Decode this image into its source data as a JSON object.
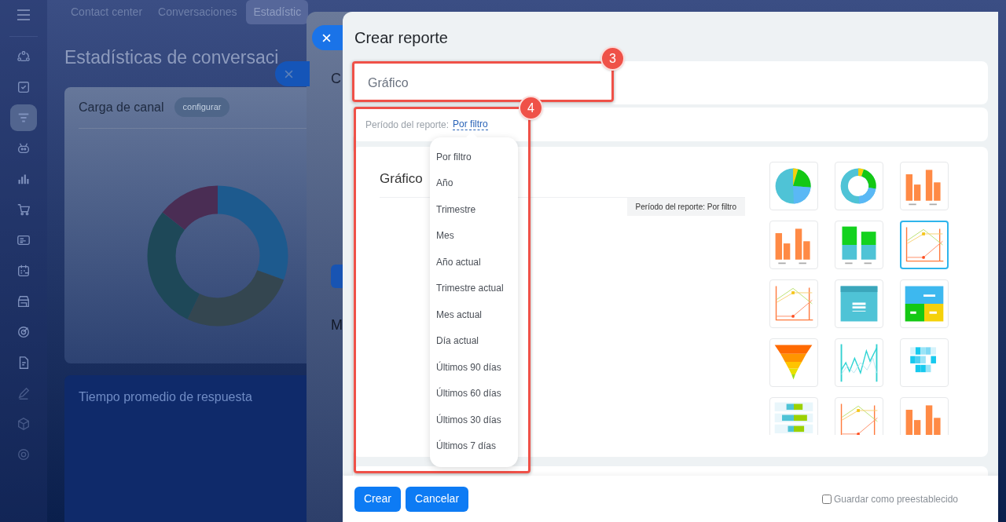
{
  "sidebar": {
    "items": [
      {
        "selected": false
      },
      {
        "selected": false
      },
      {
        "selected": true
      },
      {
        "selected": false
      },
      {
        "selected": false
      },
      {
        "selected": false
      },
      {
        "selected": false
      },
      {
        "selected": false
      },
      {
        "selected": false
      },
      {
        "selected": false
      },
      {
        "selected": false
      },
      {
        "selected": false
      },
      {
        "selected": false
      },
      {
        "selected": false
      }
    ]
  },
  "tabs": [
    {
      "label": "Contact center",
      "selected": false
    },
    {
      "label": "Conversaciones",
      "selected": false
    },
    {
      "label": "Estadístic",
      "selected": true
    }
  ],
  "page_title": "Estadísticas de conversaci",
  "cards": [
    {
      "title": "Carga de canal",
      "action": "configurar",
      "kind": "donut"
    },
    {
      "title": "Tiempo promedio de respuesta",
      "kind": "empty"
    }
  ],
  "side_panel": {
    "texts": [
      "C",
      "M"
    ]
  },
  "dialog": {
    "title": "Crear reporte",
    "name_field": {
      "value": "Gráfico"
    },
    "period": {
      "label": "Período del reporte:",
      "value": "Por filtro"
    },
    "period_options": [
      "Por filtro",
      "Año",
      "Trimestre",
      "Mes",
      "Año actual",
      "Trimestre actual",
      "Mes actual",
      "Día actual",
      "Últimos 90 días",
      "Últimos 60 días",
      "Últimos 30 días",
      "Últimos 7 días"
    ],
    "preview": {
      "title": "Gráfico",
      "tag": "Período del reporte: Por filtro"
    },
    "chart_types": [
      {
        "kind": "pie",
        "selected": false
      },
      {
        "kind": "donut",
        "selected": false
      },
      {
        "kind": "bar",
        "selected": false
      },
      {
        "kind": "bar",
        "selected": false
      },
      {
        "kind": "stacked",
        "selected": false
      },
      {
        "kind": "line",
        "selected": true
      },
      {
        "kind": "line",
        "selected": false
      },
      {
        "kind": "number",
        "selected": false
      },
      {
        "kind": "numbers",
        "selected": false
      },
      {
        "kind": "funnel",
        "selected": false
      },
      {
        "kind": "wave",
        "selected": false
      },
      {
        "kind": "heatmap",
        "selected": false
      },
      {
        "kind": "hbar",
        "selected": false
      },
      {
        "kind": "line",
        "selected": false
      },
      {
        "kind": "bar",
        "selected": false
      }
    ],
    "buttons": [
      "Crear",
      "Cancelar"
    ],
    "save_preset": {
      "label": "Guardar como preestablecido",
      "checked": false
    }
  },
  "annotations": [
    {
      "number": "3"
    },
    {
      "number": "4"
    }
  ]
}
